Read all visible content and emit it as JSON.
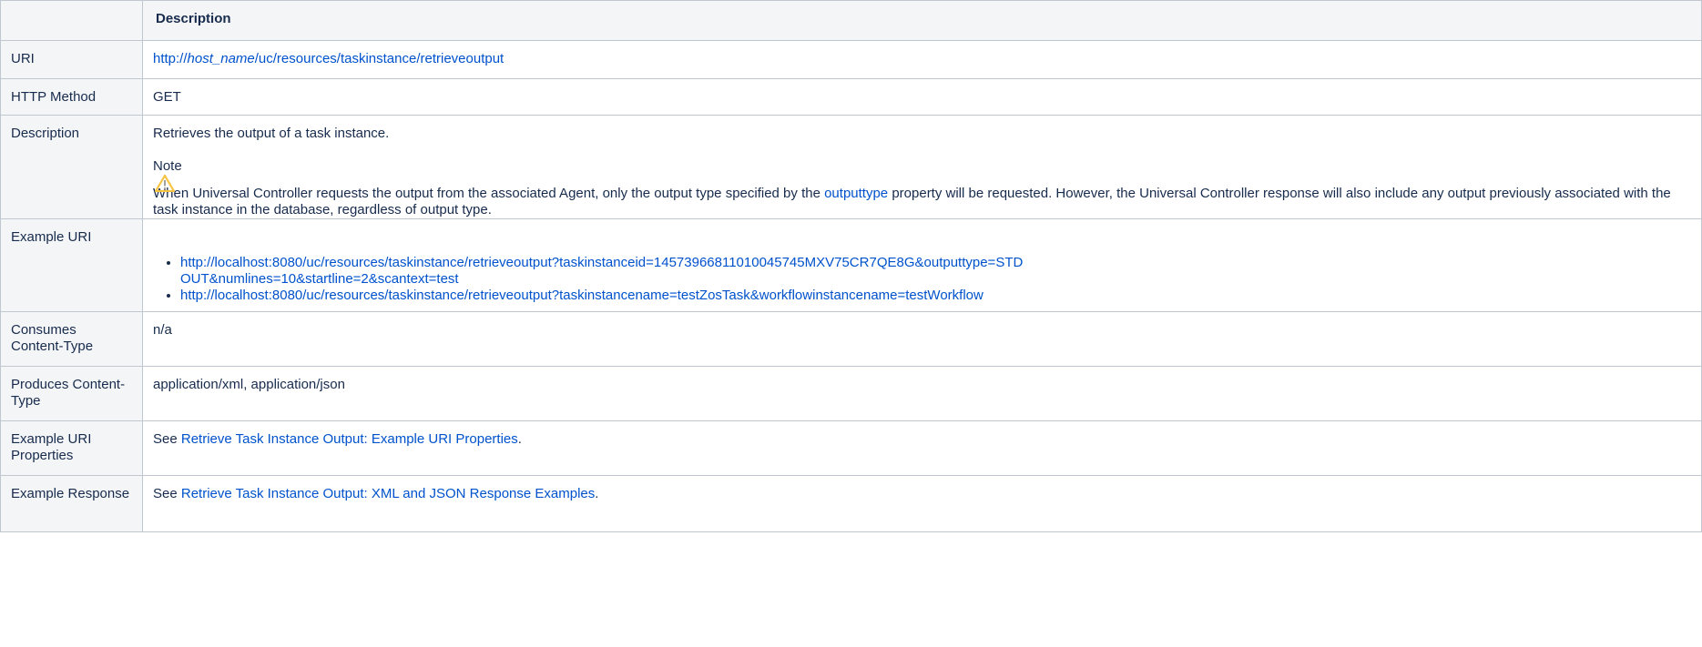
{
  "header": {
    "description_label": "Description"
  },
  "rows": {
    "uri": {
      "key": "URI",
      "prefix": "http://",
      "host": "host_name",
      "path": "/uc/resources/taskinstance/retrieveoutput"
    },
    "http_method": {
      "key": "HTTP Method",
      "value": "GET"
    },
    "description": {
      "key": "Description",
      "summary": "Retrieves the output of a task instance.",
      "note_title": "Note",
      "note_text_before": "When Universal Controller requests the output from the associated Agent, only the output type specified by the ",
      "note_link": "outputtype",
      "note_text_after": " property will be requested. However, the Universal Controller response will also include any output previously associated with the task instance in the database, regardless of output type.",
      "warning_icon": "warning-icon"
    },
    "example_uri": {
      "key": "Example URI",
      "items": [
        "http://localhost:8080/uc/resources/taskinstance/retrieveoutput?taskinstanceid=1457396681101004574​5MXV75CR7QE8G&outputtype=STDOUT&numlines=10&startline=2&scantext=test",
        "http://localhost:8080/uc/resources/taskinstance/retrieveoutput?taskinstancename=testZosTask&workflowinstancename=testWorkflow"
      ]
    },
    "consumes": {
      "key": "Consumes Content-Type",
      "value": "n/a"
    },
    "produces": {
      "key": "Produces Content-Type",
      "value": "application/xml, application/json"
    },
    "example_uri_properties": {
      "key": "Example URI Properties",
      "see": "See ",
      "link": "Retrieve Task Instance Output: Example URI Properties",
      "end": "."
    },
    "example_response": {
      "key": "Example Response",
      "see": "See ",
      "link": "Retrieve Task Instance Output: XML and JSON Response Examples",
      "end": "."
    }
  },
  "colors": {
    "link": "#0052cc",
    "header_bg": "#f4f5f7",
    "border": "#c1c7d0",
    "warning": "#f6c342"
  }
}
